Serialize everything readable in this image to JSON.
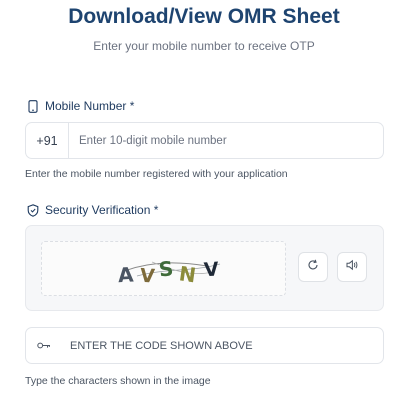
{
  "header": {
    "title": "Download/View OMR Sheet",
    "subtitle": "Enter your mobile number to receive OTP"
  },
  "mobile": {
    "label": "Mobile Number *",
    "prefix": "+91",
    "placeholder": "Enter 10-digit mobile number",
    "value": "",
    "help": "Enter the mobile number registered with your application",
    "icon": "phone-icon"
  },
  "security": {
    "label": "Security Verification *",
    "icon": "shield-icon",
    "captcha_chars": [
      "A",
      "V",
      "S",
      "N",
      "V"
    ],
    "refresh_icon": "refresh-icon",
    "audio_icon": "speaker-icon"
  },
  "code": {
    "placeholder": "ENTER THE CODE SHOWN ABOVE",
    "value": "",
    "help": "Type the characters shown in the image",
    "icon": "key-icon"
  },
  "colors": {
    "title": "#1e4470",
    "label": "#1e3a5f",
    "border": "#e2e5ea",
    "panel": "#f6f7f9"
  }
}
